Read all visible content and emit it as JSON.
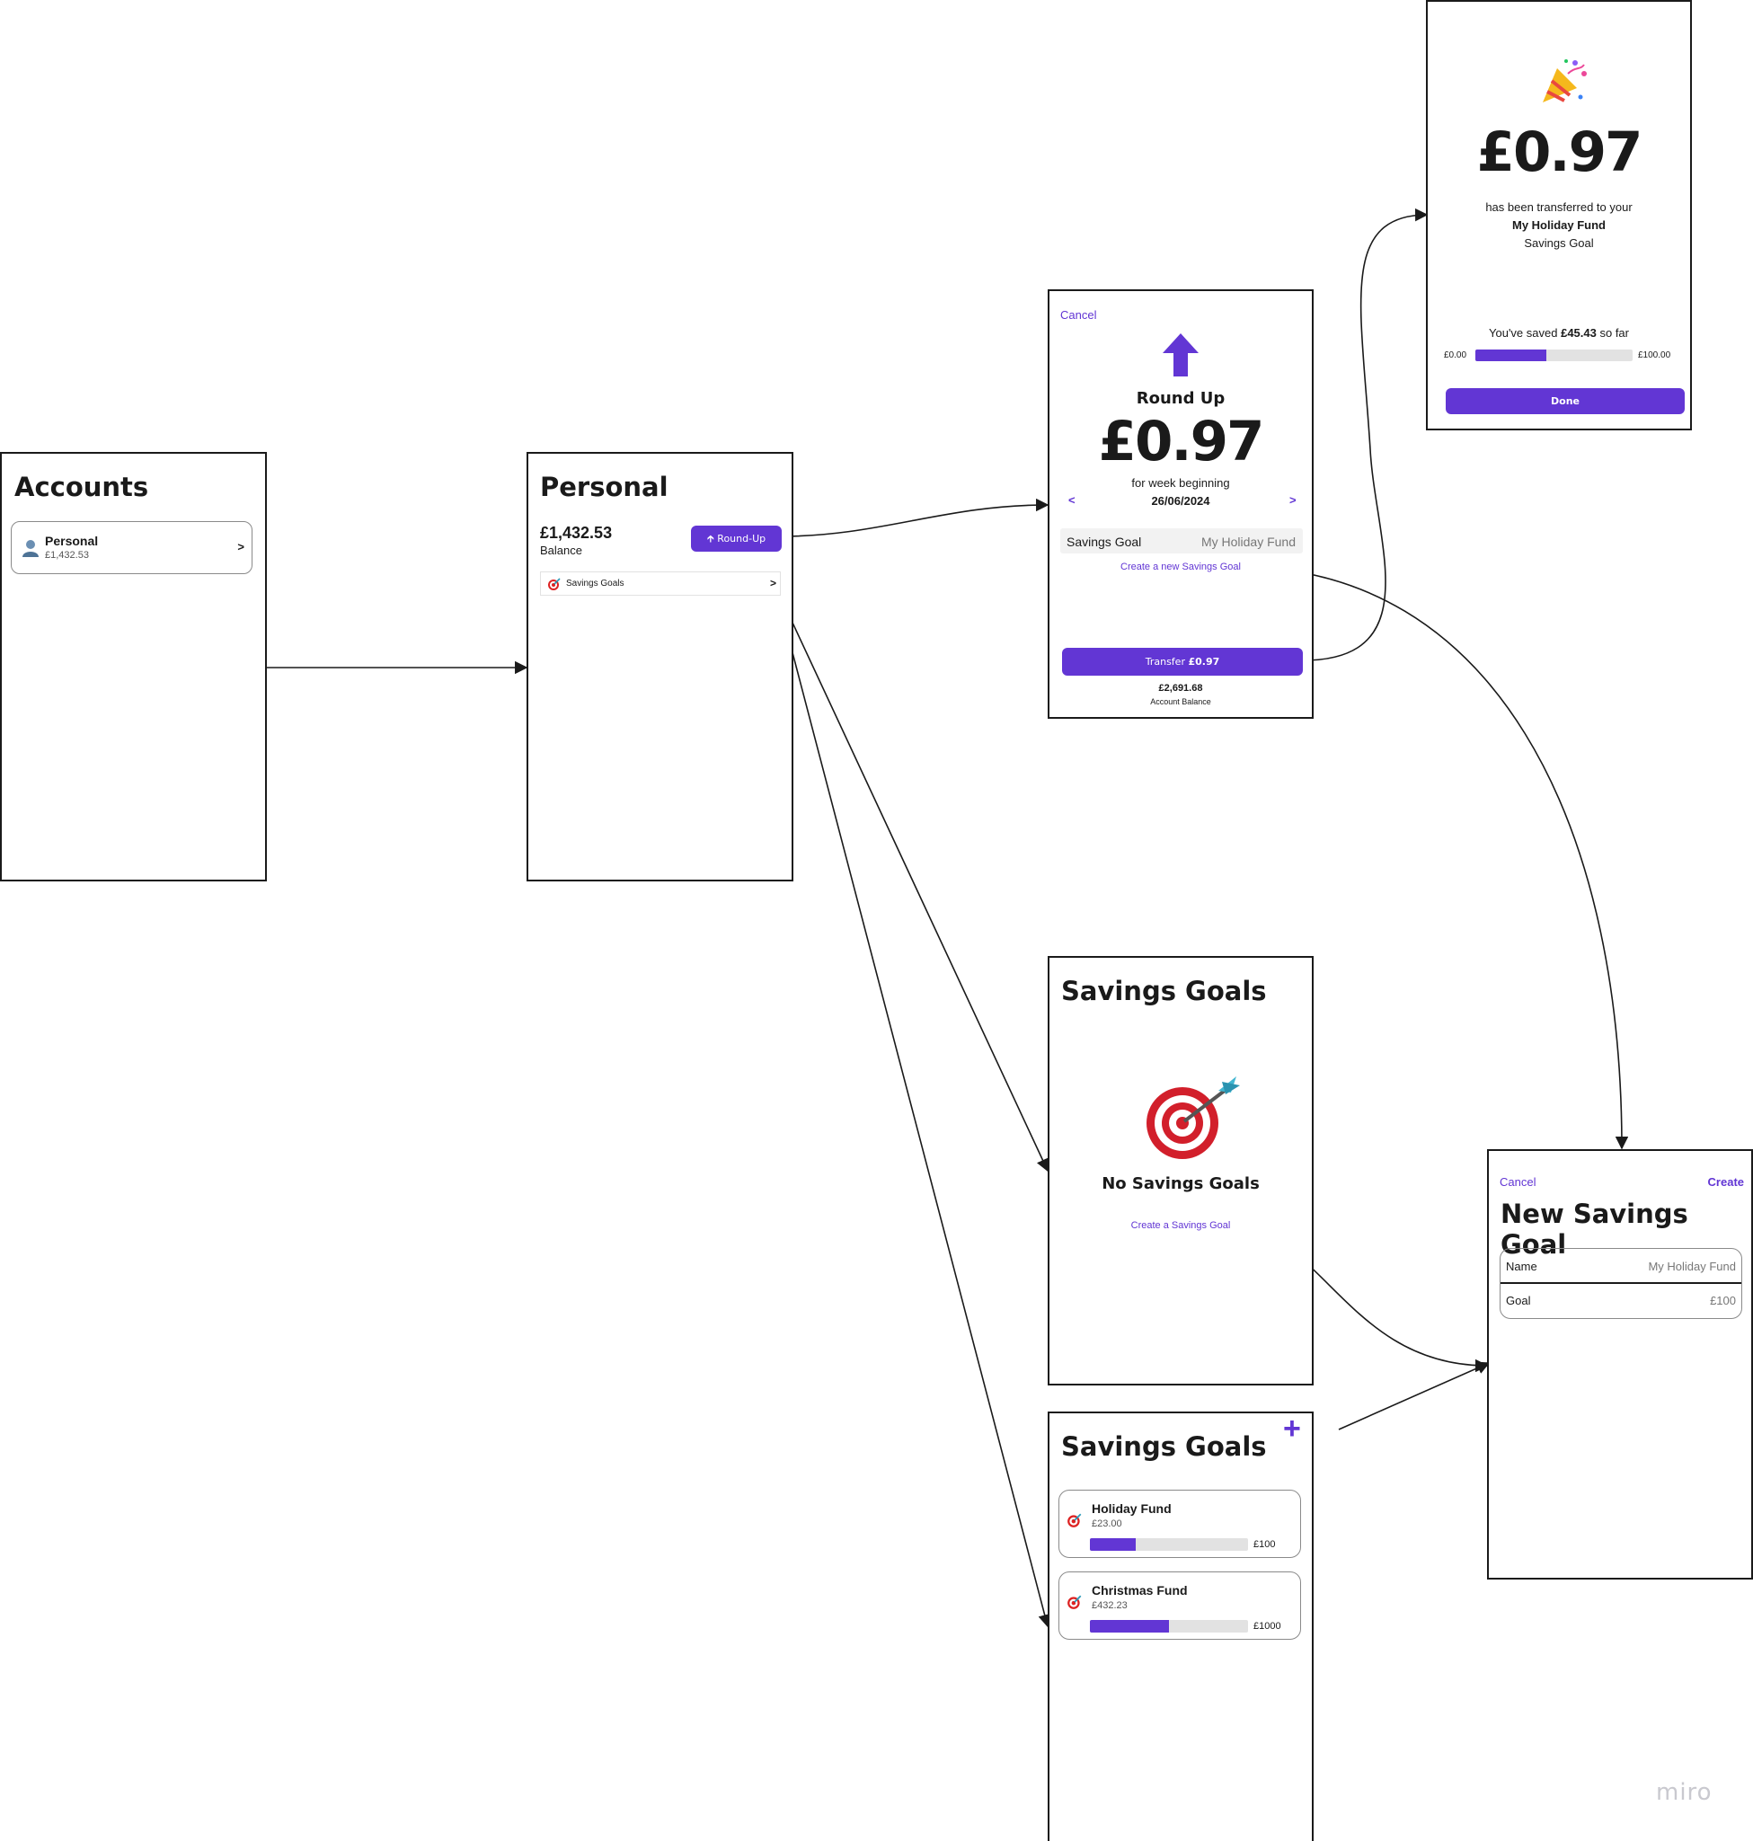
{
  "accent_color": "#6236d4",
  "accounts": {
    "title": "Accounts",
    "item": {
      "name": "Personal",
      "balance": "£1,432.53",
      "chevron": ">",
      "icon": "person-icon"
    }
  },
  "personal": {
    "title": "Personal",
    "balance": "£1,432.53",
    "balance_label": "Balance",
    "roundup_button": "Round-Up",
    "savings_goals_row": {
      "label": "Savings Goals",
      "chevron": ">",
      "icon": "target-icon"
    }
  },
  "round_up": {
    "cancel": "Cancel",
    "heading": "Round Up",
    "amount": "£0.97",
    "week_label": "for week beginning",
    "week_date": "26/06/2024",
    "prev": "<",
    "next": ">",
    "goal_label": "Savings Goal",
    "goal_value": "My Holiday Fund",
    "create_link": "Create a new Savings Goal",
    "transfer_button_prefix": "Transfer ",
    "transfer_button_amount": "£0.97",
    "account_balance": "£2,691.68",
    "account_balance_label": "Account Balance"
  },
  "transfer_success": {
    "icon": "party-popper-icon",
    "amount": "£0.97",
    "line1": "has been transferred to your",
    "goal_name": "My Holiday Fund",
    "line3": "Savings Goal",
    "saved_prefix": "You've saved ",
    "saved_amount": "£45.43",
    "saved_suffix": " so far",
    "min_label": "£0.00",
    "max_label": "£100.00",
    "progress_fraction": 0.45,
    "done_button": "Done"
  },
  "no_goals": {
    "title": "Savings Goals",
    "empty_text": "No Savings Goals",
    "create_link": "Create a Savings Goal"
  },
  "goals_list": {
    "title": "Savings Goals",
    "add_icon": "+",
    "goals": [
      {
        "name": "Holiday Fund",
        "saved": "£23.00",
        "target": "£100",
        "progress": 0.29
      },
      {
        "name": "Christmas Fund",
        "saved": "£432.23",
        "target": "£1000",
        "progress": 0.5
      }
    ]
  },
  "new_goal": {
    "cancel": "Cancel",
    "create": "Create",
    "title": "New Savings Goal",
    "name_label": "Name",
    "name_placeholder": "My Holiday Fund",
    "goal_label": "Goal",
    "goal_placeholder": "£100"
  },
  "watermark": "miro"
}
